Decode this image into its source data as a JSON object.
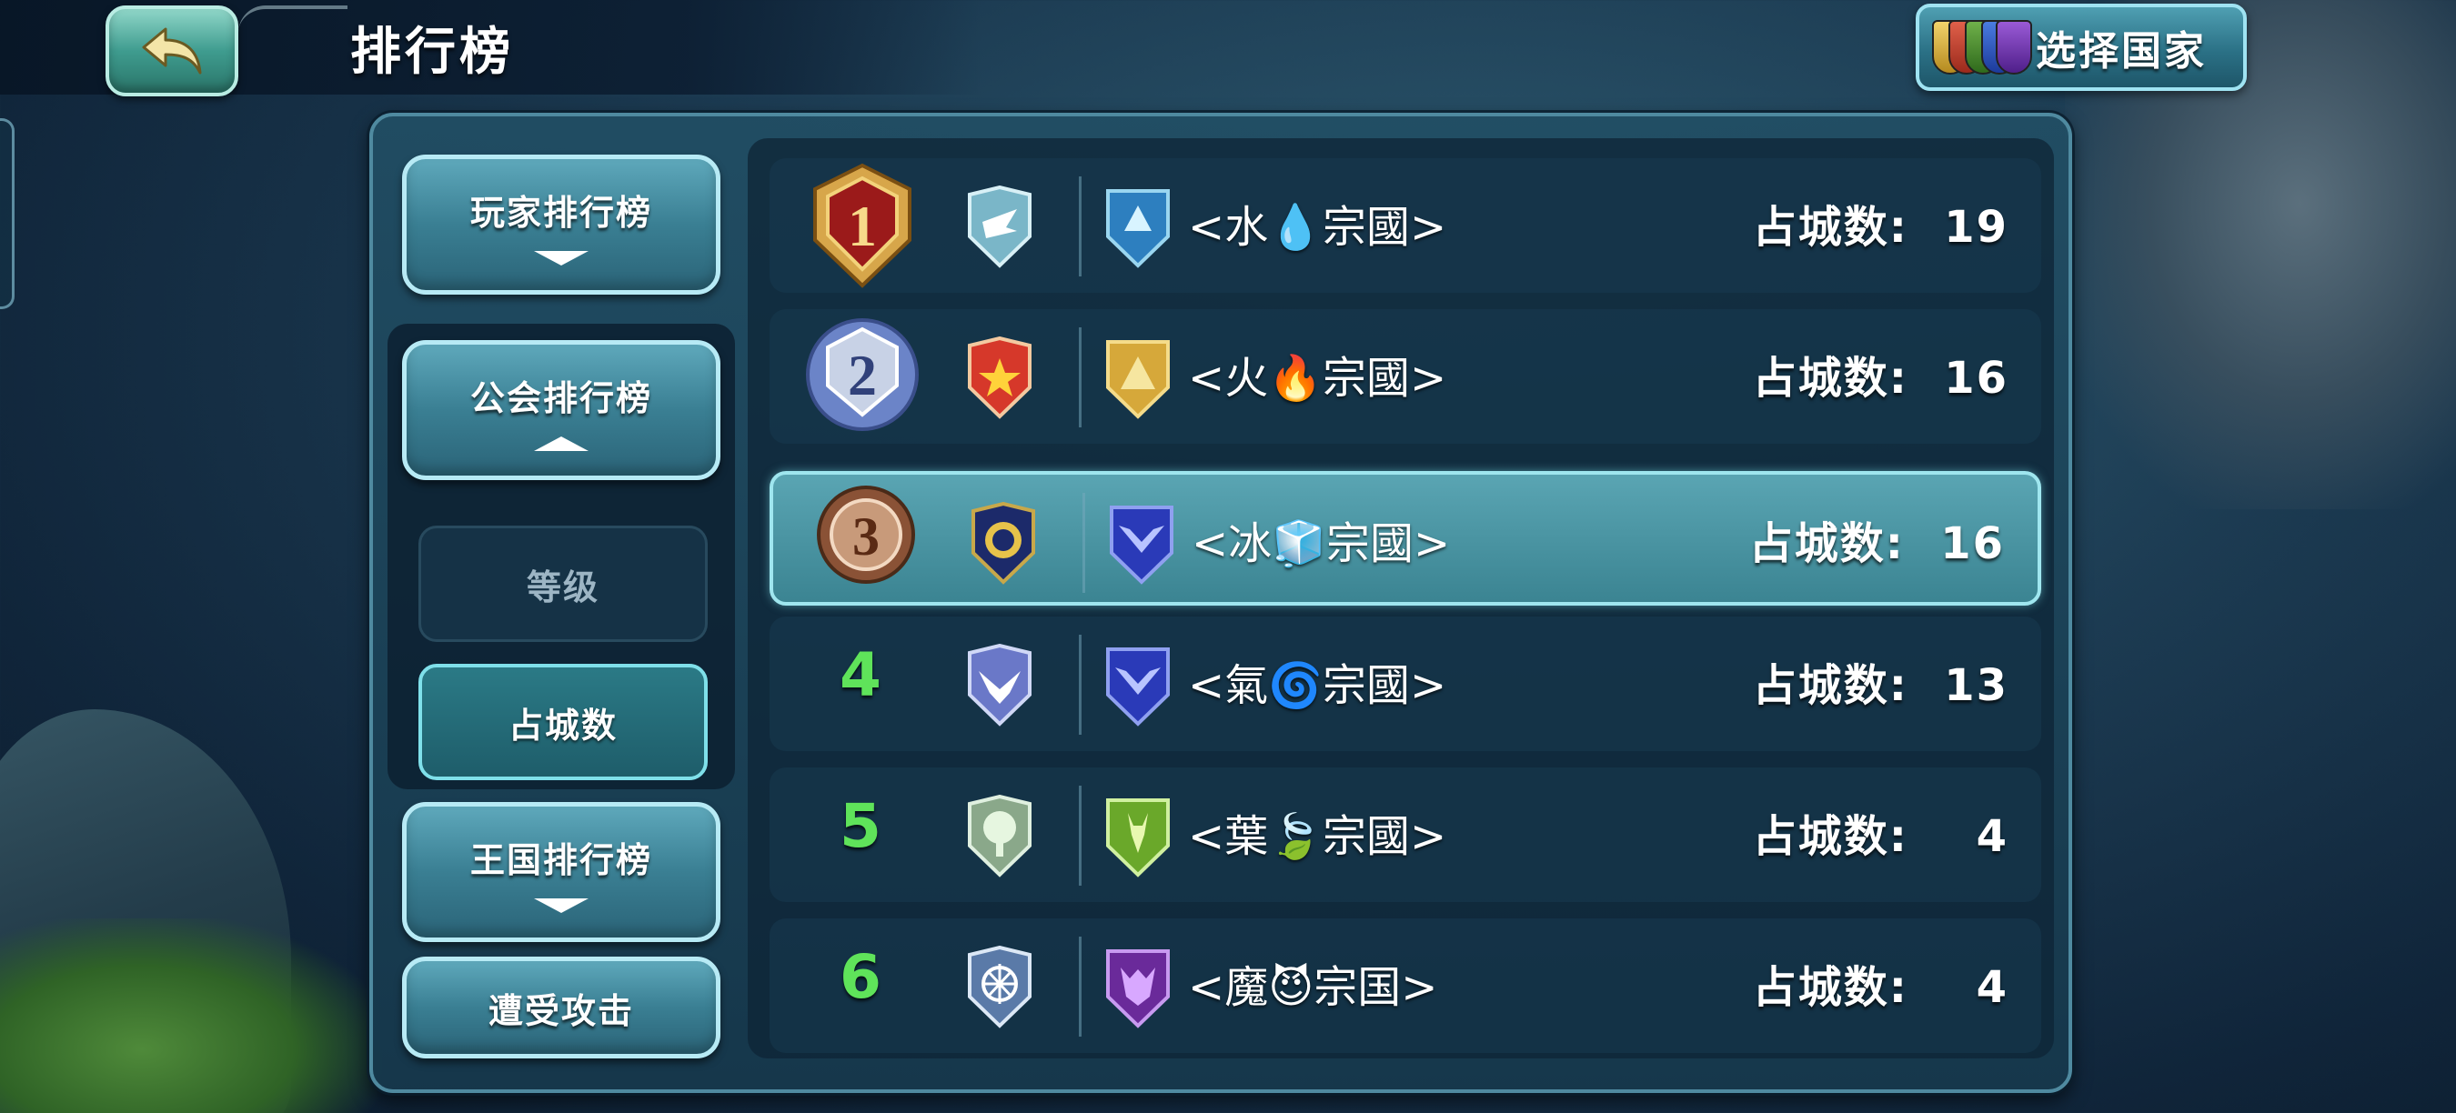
{
  "header": {
    "title": "排行榜",
    "select_country_label": "选择国家"
  },
  "menu": {
    "player_ranking": "玩家排行榜",
    "guild_ranking": "公会排行榜",
    "sub_level": "等级",
    "sub_cities": "占城数",
    "kingdom_ranking": "王国排行榜",
    "under_attack": "遭受攻击"
  },
  "colors": {
    "rank_number": "#5fe35a",
    "highlight_row": "#4a96a4"
  },
  "rankings": [
    {
      "rank": "1",
      "medal": "gold-medal-icon",
      "guild_emblem": "eagle-shield-icon",
      "nation_emblem": "blue-crown-shield-icon",
      "name": "<水💧宗國>",
      "stat_label": "占城数:",
      "stat_value": "19"
    },
    {
      "rank": "2",
      "medal": "silver-medal-icon",
      "guild_emblem": "star-shield-icon",
      "nation_emblem": "gold-pyramid-shield-icon",
      "name": "<火🔥宗國>",
      "stat_label": "占城数:",
      "stat_value": "16"
    },
    {
      "rank": "3",
      "medal": "bronze-medal-icon",
      "guild_emblem": "round-seal-shield-icon",
      "nation_emblem": "blue-wing-shield-icon",
      "name": "<冰🧊宗國>",
      "stat_label": "占城数:",
      "stat_value": "16"
    },
    {
      "rank": "4",
      "medal": "",
      "guild_emblem": "phoenix-shield-icon",
      "nation_emblem": "blue-wing-shield-icon",
      "name": "<氣🌀宗國>",
      "stat_label": "占城数:",
      "stat_value": "13"
    },
    {
      "rank": "5",
      "medal": "",
      "guild_emblem": "tree-shield-icon",
      "nation_emblem": "green-deer-shield-icon",
      "name": "<葉🍃宗國>",
      "stat_label": "占城数:",
      "stat_value": "4"
    },
    {
      "rank": "6",
      "medal": "",
      "guild_emblem": "snowflake-shield-icon",
      "nation_emblem": "purple-demon-shield-icon",
      "name": "<魔😈宗国>",
      "stat_label": "占城数:",
      "stat_value": "4"
    }
  ]
}
